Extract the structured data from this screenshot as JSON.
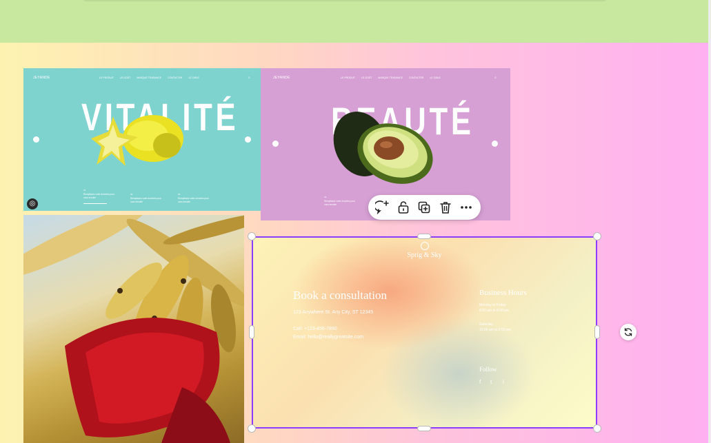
{
  "colors": {
    "selection": "#8b3dff",
    "slide1_bg": "#7ed3cf",
    "slide2_bg": "#d6a0d4",
    "top_strip": "#c8e8a0"
  },
  "slide1": {
    "brand": "JEYANDE",
    "nav": [
      "LE PRODUIT",
      "LE GOÛT",
      "MARQUE TENDANCE",
      "CONTACTER",
      "LE CIBLE"
    ],
    "title": "VITALITÉ",
    "columns": [
      {
        "num": "01",
        "text": "Remplissez votre données pour vous ensuite"
      },
      {
        "num": "02",
        "text": "Remplissez votre données pour vous ensuite"
      },
      {
        "num": "03",
        "text": "Remplissez votre données pour vous ensuite"
      }
    ],
    "badge_icon": "lens-icon"
  },
  "slide2": {
    "brand": "JEYANDE",
    "nav": [
      "LE PRODUIT",
      "LE GOÛT",
      "MARQUE TENDANCE",
      "CONTACTER",
      "LE CIBLE"
    ],
    "title": "BEAUTÉ",
    "column": {
      "num": "01",
      "text": "Remplissez votre données pour vous ensuite"
    }
  },
  "toolbar": {
    "items": [
      {
        "name": "comment-add-icon"
      },
      {
        "name": "lock-icon"
      },
      {
        "name": "duplicate-icon"
      },
      {
        "name": "trash-icon"
      },
      {
        "name": "more-icon"
      }
    ]
  },
  "slide3": {
    "logo": "Sprig & Sky",
    "title": "Book a consultation",
    "address": "123 Anywhere St. Any City, ST 12345",
    "call": "Call: +123-456-7890",
    "email": "Email: hello@reallygreatsite.com",
    "hours_title": "Business Hours",
    "hours_line1": "Monday to Friday",
    "hours_line2": "8:00 am to 5:00 pm",
    "hours_line3": "Saturday",
    "hours_line4": "10:00 am to 2:00 pm",
    "follow": "Follow",
    "social": [
      "f",
      "t",
      "i"
    ]
  }
}
